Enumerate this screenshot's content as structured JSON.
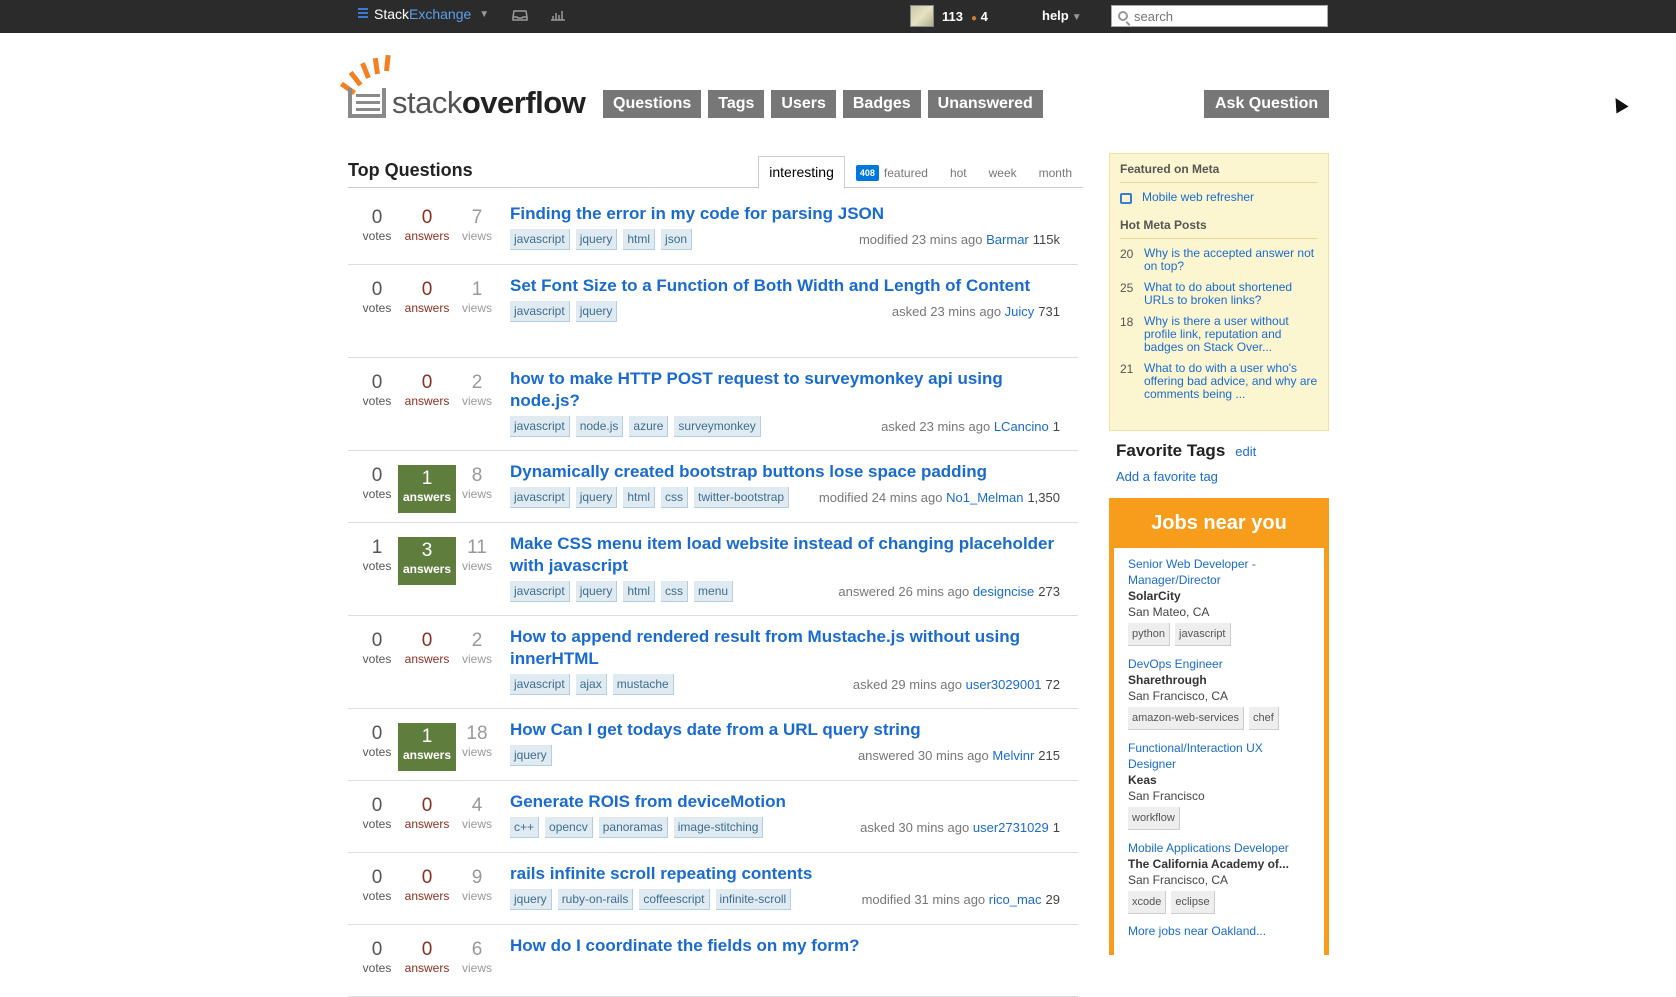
{
  "topbar": {
    "brand_a": "Stack",
    "brand_b": "Exchange",
    "reputation": "113",
    "bronze_badges": "4",
    "help": "help",
    "search_placeholder": "search"
  },
  "header": {
    "logo_a": "stack",
    "logo_b": "overflow",
    "nav": [
      "Questions",
      "Tags",
      "Users",
      "Badges",
      "Unanswered"
    ],
    "ask": "Ask Question"
  },
  "questions": {
    "title": "Top Questions",
    "tabs": [
      {
        "label": "interesting"
      },
      {
        "label": "featured",
        "badge": "408"
      },
      {
        "label": "hot"
      },
      {
        "label": "week"
      },
      {
        "label": "month"
      }
    ],
    "items": [
      {
        "votes": "0",
        "votes_label": "votes",
        "answers": "0",
        "answers_label": "answers",
        "accepted": false,
        "views": "7",
        "views_label": "views",
        "title": "Finding the error in my code for parsing JSON",
        "tags": [
          "javascript",
          "jquery",
          "html",
          "json"
        ],
        "action": "modified 23 mins ago",
        "user": "Barmar",
        "rep": "115k"
      },
      {
        "votes": "0",
        "votes_label": "votes",
        "answers": "0",
        "answers_label": "answers",
        "accepted": false,
        "views": "1",
        "views_label": "views",
        "title": "Set Font Size to a Function of Both Width and Length of Content",
        "tags": [
          "javascript",
          "jquery"
        ],
        "action": "asked 23 mins ago",
        "user": "Juicy",
        "rep": "731"
      },
      {
        "votes": "0",
        "votes_label": "votes",
        "answers": "0",
        "answers_label": "answers",
        "accepted": false,
        "views": "2",
        "views_label": "views",
        "title": "how to make HTTP POST request to surveymonkey api using node.js?",
        "tags": [
          "javascript",
          "node.js",
          "azure",
          "surveymonkey"
        ],
        "action": "asked 23 mins ago",
        "user": "LCancino",
        "rep": "1"
      },
      {
        "votes": "0",
        "votes_label": "votes",
        "answers": "1",
        "answers_label": "answers",
        "accepted": true,
        "views": "8",
        "views_label": "views",
        "title": "Dynamically created bootstrap buttons lose space padding",
        "tags": [
          "javascript",
          "jquery",
          "html",
          "css",
          "twitter-bootstrap"
        ],
        "action": "modified 24 mins ago",
        "user": "No1_Melman",
        "rep": "1,350"
      },
      {
        "votes": "1",
        "votes_label": "votes",
        "answers": "3",
        "answers_label": "answers",
        "accepted": true,
        "views": "11",
        "views_label": "views",
        "title": "Make CSS menu item load website instead of changing placeholder with javascript",
        "tags": [
          "javascript",
          "jquery",
          "html",
          "css",
          "menu"
        ],
        "action": "answered 26 mins ago",
        "user": "designcise",
        "rep": "273"
      },
      {
        "votes": "0",
        "votes_label": "votes",
        "answers": "0",
        "answers_label": "answers",
        "accepted": false,
        "views": "2",
        "views_label": "views",
        "title": "How to append rendered result from Mustache.js without using innerHTML",
        "tags": [
          "javascript",
          "ajax",
          "mustache"
        ],
        "action": "asked 29 mins ago",
        "user": "user3029001",
        "rep": "72"
      },
      {
        "votes": "0",
        "votes_label": "votes",
        "answers": "1",
        "answers_label": "answers",
        "accepted": true,
        "views": "18",
        "views_label": "views",
        "title": "How Can I get todays date from a URL query string",
        "tags": [
          "jquery"
        ],
        "action": "answered 30 mins ago",
        "user": "Melvinr",
        "rep": "215"
      },
      {
        "votes": "0",
        "votes_label": "votes",
        "answers": "0",
        "answers_label": "answers",
        "accepted": false,
        "views": "4",
        "views_label": "views",
        "title": "Generate ROIS from deviceMotion",
        "tags": [
          "c++",
          "opencv",
          "panoramas",
          "image-stitching"
        ],
        "action": "asked 30 mins ago",
        "user": "user2731029",
        "rep": "1"
      },
      {
        "votes": "0",
        "votes_label": "votes",
        "answers": "0",
        "answers_label": "answers",
        "accepted": false,
        "views": "9",
        "views_label": "views",
        "title": "rails infinite scroll repeating contents",
        "tags": [
          "jquery",
          "ruby-on-rails",
          "coffeescript",
          "infinite-scroll"
        ],
        "action": "modified 31 mins ago",
        "user": "rico_mac",
        "rep": "29"
      },
      {
        "votes": "0",
        "votes_label": "votes",
        "answers": "0",
        "answers_label": "answers",
        "accepted": false,
        "views": "6",
        "views_label": "views",
        "title": "How do I coordinate the fields on my form?",
        "tags": [],
        "action": "",
        "user": "",
        "rep": ""
      }
    ]
  },
  "meta": {
    "featured_title": "Featured on Meta",
    "featured_item": "Mobile web refresher",
    "hot_title": "Hot Meta Posts",
    "hot_posts": [
      {
        "n": "20",
        "title": "Why is the accepted answer not on top?"
      },
      {
        "n": "25",
        "title": "What to do about shortened URLs to broken links?"
      },
      {
        "n": "18",
        "title": "Why is there a user without profile link, reputation and badges on Stack Over..."
      },
      {
        "n": "21",
        "title": "What to do with a user who's offering bad advice, and why are comments being ..."
      }
    ]
  },
  "favorites": {
    "title": "Favorite Tags",
    "edit": "edit",
    "add": "Add a favorite tag"
  },
  "jobs": {
    "title": "Jobs near you",
    "items": [
      {
        "title": "Senior Web Developer - Manager/Director",
        "company": "SolarCity",
        "location": "San Mateo, CA",
        "tags": [
          "python",
          "javascript"
        ]
      },
      {
        "title": "DevOps Engineer",
        "company": "Sharethrough",
        "location": "San Francisco, CA",
        "tags": [
          "amazon-web-services",
          "chef"
        ]
      },
      {
        "title": "Functional/Interaction UX Designer",
        "company": "Keas",
        "location": "San Francisco",
        "tags": [
          "workflow"
        ]
      },
      {
        "title": "Mobile Applications Developer",
        "company": "The California Academy of...",
        "location": "San Francisco, CA",
        "tags": [
          "xcode",
          "eclipse"
        ]
      }
    ],
    "more": "More jobs near Oakland..."
  },
  "colors": {
    "topbar": "#2b2b2b",
    "accent_orange": "#f48024",
    "link_blue": "#1a6bd1",
    "accepted_green": "#5f7e3e",
    "jobs_orange": "#f89c1c"
  }
}
